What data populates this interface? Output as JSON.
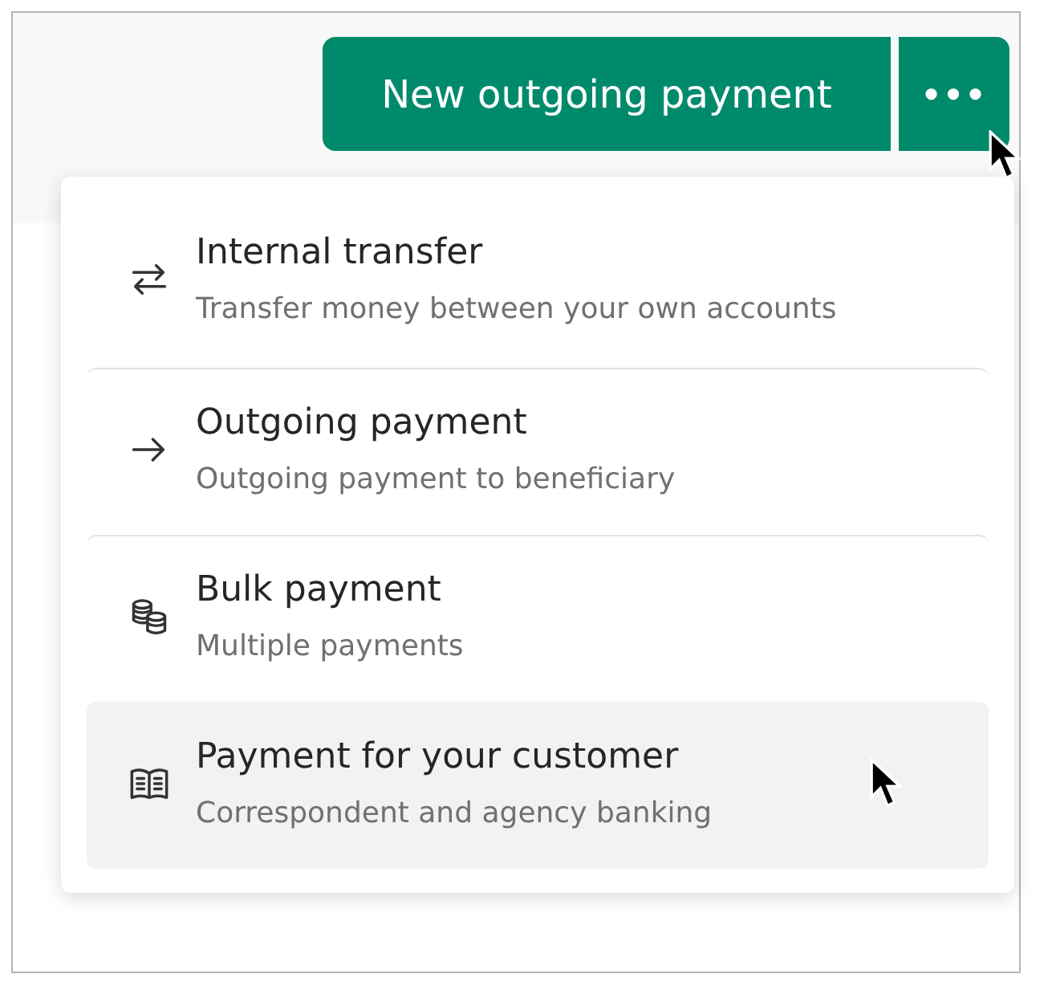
{
  "primary_button": {
    "label": "New outgoing payment"
  },
  "more_button": {
    "label": "•••"
  },
  "menu": {
    "items": [
      {
        "kind": "transfer",
        "title": "Internal transfer",
        "subtitle": "Transfer money between your own accounts",
        "selected": false
      },
      {
        "kind": "outgoing",
        "title": "Outgoing payment",
        "subtitle": "Outgoing payment to beneficiary",
        "selected": false
      },
      {
        "kind": "bulk",
        "title": "Bulk payment",
        "subtitle": "Multiple payments",
        "selected": false
      },
      {
        "kind": "customer",
        "title": "Payment for your customer",
        "subtitle": "Correspondent and agency banking",
        "selected": true
      }
    ]
  }
}
